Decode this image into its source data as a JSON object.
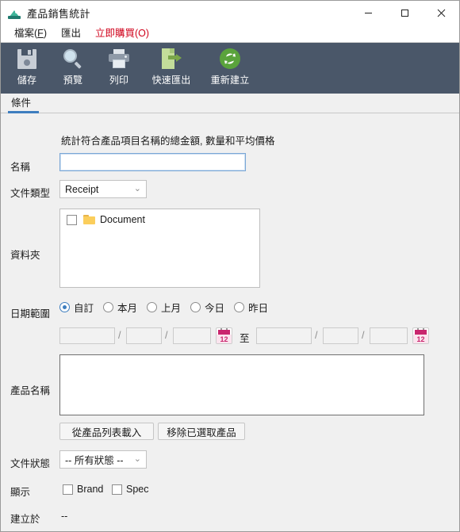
{
  "window": {
    "title": "產品銷售統計",
    "app_icon": "scanner-icon",
    "minimize_label": "minimize",
    "maximize_label": "maximize",
    "close_label": "close"
  },
  "menubar": {
    "items": [
      {
        "label": "檔案(F)",
        "mnemonic": "F",
        "accent": false
      },
      {
        "label": "匯出",
        "mnemonic": "",
        "accent": false
      },
      {
        "label": "立即購買(O)",
        "mnemonic": "",
        "accent": true
      }
    ],
    "accent_color": "#d0021b"
  },
  "toolbar": {
    "background": "#4a5769",
    "buttons": [
      {
        "label": "儲存",
        "icon": "floppy-disk-icon"
      },
      {
        "label": "預覽",
        "icon": "magnifier-icon"
      },
      {
        "label": "列印",
        "icon": "printer-icon"
      },
      {
        "label": "快速匯出",
        "icon": "document-export-icon"
      },
      {
        "label": "重新建立",
        "icon": "refresh-icon"
      }
    ]
  },
  "tabs": [
    {
      "label": "條件",
      "active": true
    }
  ],
  "tab_accent_color": "#3e7ebf",
  "form": {
    "hint": "統計符合產品項目名稱的總金額, 數量和平均價格",
    "name": {
      "label": "名稱",
      "value": "",
      "placeholder": ""
    },
    "doc_type": {
      "label": "文件類型",
      "value": "Receipt"
    },
    "folder": {
      "label": "資料夾",
      "items": [
        {
          "label": "Document",
          "checked": false,
          "icon": "folder-icon"
        }
      ]
    },
    "date_range": {
      "label": "日期範圍",
      "options": [
        {
          "label": "自訂",
          "selected": true
        },
        {
          "label": "本月",
          "selected": false
        },
        {
          "label": "上月",
          "selected": false
        },
        {
          "label": "今日",
          "selected": false
        },
        {
          "label": "昨日",
          "selected": false
        }
      ],
      "separator": "/",
      "to_label": "至",
      "calendar_icon_day": "12",
      "from": {
        "d1": "",
        "d2": "",
        "d3": ""
      },
      "to": {
        "d1": "",
        "d2": "",
        "d3": ""
      }
    },
    "product_name": {
      "label": "產品名稱",
      "value": "",
      "load_button": "從產品列表載入",
      "remove_button": "移除已選取產品"
    },
    "doc_status": {
      "label": "文件狀態",
      "value": "-- 所有狀態 --"
    },
    "display": {
      "label": "顯示",
      "checkboxes": [
        {
          "label": "Brand",
          "checked": false
        },
        {
          "label": "Spec",
          "checked": false
        }
      ]
    },
    "created_on": {
      "label": "建立於",
      "value": "--"
    }
  }
}
